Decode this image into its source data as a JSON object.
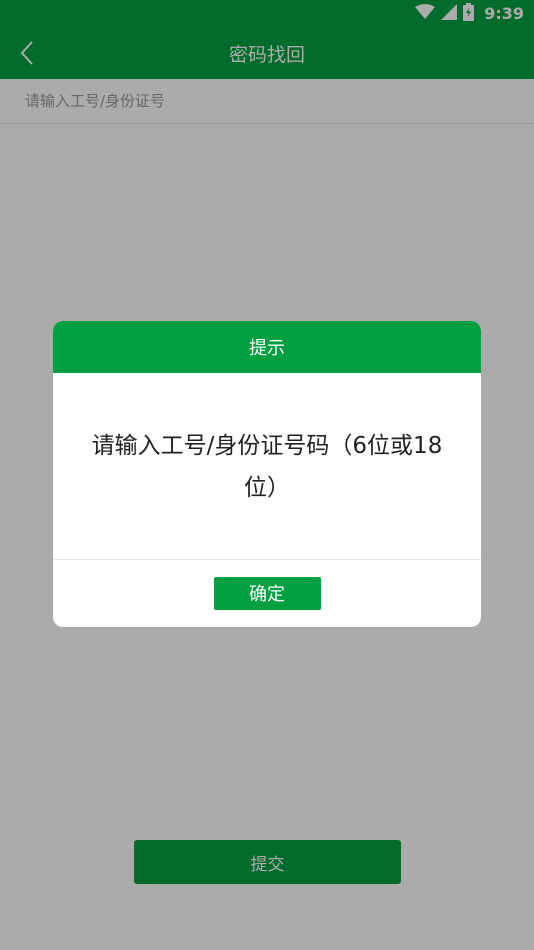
{
  "status_bar": {
    "time": "9:39",
    "icons": [
      "wifi-icon",
      "signal-icon",
      "battery-icon"
    ]
  },
  "app_bar": {
    "title": "密码找回",
    "back_icon": "chevron-left-icon"
  },
  "form": {
    "id_input_placeholder": "请输入工号/身份证号",
    "submit_label": "提交"
  },
  "dialog": {
    "title": "提示",
    "message": "请输入工号/身份证号码（6位或18位）",
    "confirm_label": "确定"
  },
  "colors": {
    "primary_green": "#00a040",
    "overlay": "rgba(0,0,0,0.33)"
  }
}
